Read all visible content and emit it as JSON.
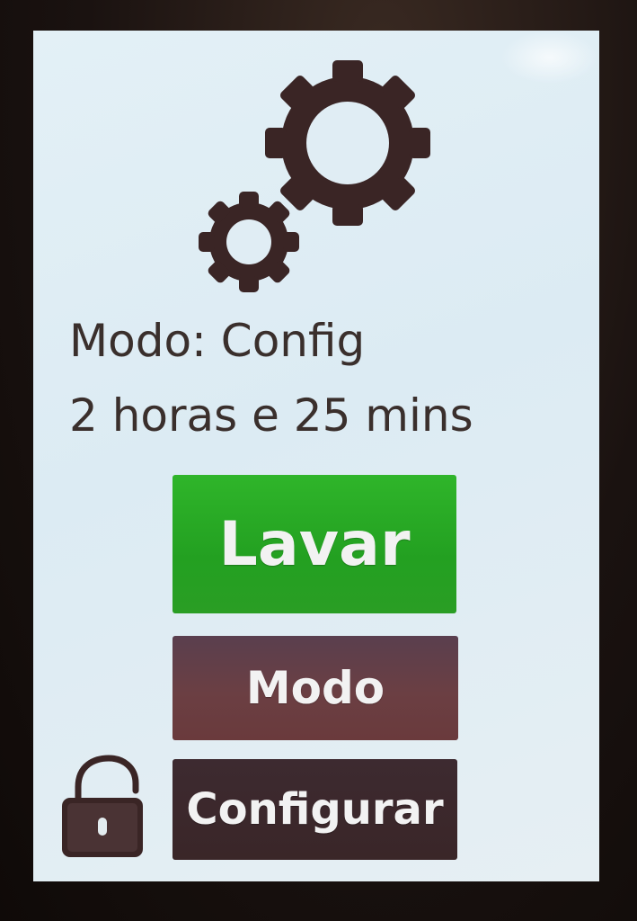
{
  "status": {
    "mode_line": "Modo: Config",
    "time_line": "2 horas e 25 mins"
  },
  "buttons": {
    "wash_label": "Lavar",
    "mode_label": "Modo",
    "config_label": "Configurar"
  },
  "icons": {
    "header": "gears-icon",
    "lock": "unlocked-padlock-icon"
  },
  "colors": {
    "wash_button": "#26a523",
    "mode_button": "#643e46",
    "config_button": "#3b282c",
    "icon_color": "#3a2525",
    "text_color": "#3a2f2c"
  }
}
